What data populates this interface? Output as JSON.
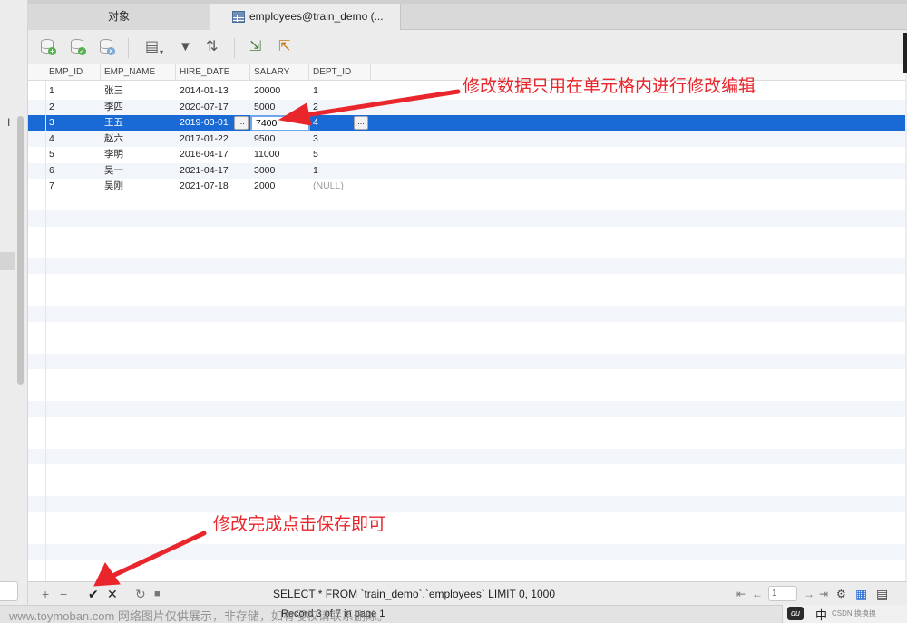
{
  "tabs": {
    "objects": "对象",
    "employees": "employees@train_demo (..."
  },
  "grid": {
    "columns": [
      "EMP_ID",
      "EMP_NAME",
      "HIRE_DATE",
      "SALARY",
      "DEPT_ID"
    ],
    "rows": [
      {
        "emp_id": "1",
        "emp_name": "张三",
        "hire_date": "2014-01-13",
        "salary": "20000",
        "dept_id": "1"
      },
      {
        "emp_id": "2",
        "emp_name": "李四",
        "hire_date": "2020-07-17",
        "salary": "5000",
        "dept_id": "2"
      },
      {
        "emp_id": "3",
        "emp_name": "王五",
        "hire_date": "2019-03-01",
        "salary": "7400",
        "dept_id": "4"
      },
      {
        "emp_id": "4",
        "emp_name": "赵六",
        "hire_date": "2017-01-22",
        "salary": "9500",
        "dept_id": "3"
      },
      {
        "emp_id": "5",
        "emp_name": "李明",
        "hire_date": "2016-04-17",
        "salary": "11000",
        "dept_id": "5"
      },
      {
        "emp_id": "6",
        "emp_name": "吴一",
        "hire_date": "2021-04-17",
        "salary": "3000",
        "dept_id": "1"
      },
      {
        "emp_id": "7",
        "emp_name": "吴刚",
        "hire_date": "2021-07-18",
        "salary": "2000",
        "dept_id": "(NULL)"
      }
    ],
    "ellipsis": "...",
    "row_marker": "I"
  },
  "annotations": {
    "top": "修改数据只用在单元格内进行修改编辑",
    "bottom": "修改完成点击保存即可",
    "color": "#e8262b"
  },
  "bottombar": {
    "add": "+",
    "remove": "−",
    "save": "✔",
    "discard": "✕",
    "refresh": "↻",
    "stop": "■",
    "sql": "SELECT * FROM `train_demo`.`employees` LIMIT 0, 1000",
    "first": "⇤",
    "prev": "←",
    "page": "1",
    "next": "→",
    "last": "⇥",
    "settings": "⚙",
    "grid_view": "▦",
    "form_view": "▤"
  },
  "statusbar": {
    "record": "Record 3 of 7 in page 1",
    "watermark": "www.toymoban.com 网络图片仅供展示，非存储，如有侵权请联系删除。"
  },
  "ime": {
    "logo": "du",
    "lang": "中",
    "extra": "CSDN 换换换"
  },
  "icons": {
    "db_add": "+",
    "db_ok": "✓",
    "db_cancel": "×",
    "doc": "▤",
    "filter": "▼",
    "sort": "⇅",
    "import": "⇲",
    "export": "⇱"
  }
}
